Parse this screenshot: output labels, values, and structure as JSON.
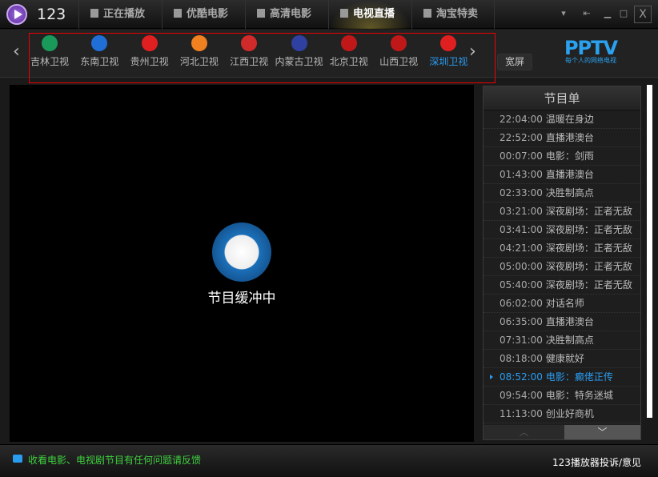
{
  "app": {
    "name": "123"
  },
  "nav_tabs": [
    {
      "label": "正在播放"
    },
    {
      "label": "优酷电影"
    },
    {
      "label": "高清电影"
    },
    {
      "label": "电视直播"
    },
    {
      "label": "淘宝特卖"
    }
  ],
  "window_buttons": {
    "close": "X"
  },
  "channels": [
    {
      "label": "吉林卫视",
      "color": "#1a9a5a"
    },
    {
      "label": "东南卫视",
      "color": "#1f6fd6"
    },
    {
      "label": "贵州卫视",
      "color": "#e02020"
    },
    {
      "label": "河北卫视",
      "color": "#f08020"
    },
    {
      "label": "江西卫视",
      "color": "#d02a2a"
    },
    {
      "label": "内蒙古卫视",
      "color": "#3040a0"
    },
    {
      "label": "北京卫视",
      "color": "#c01818"
    },
    {
      "label": "山西卫视",
      "color": "#c01818"
    },
    {
      "label": "深圳卫视",
      "color": "#e02020"
    }
  ],
  "wide_label": "宽屏",
  "pptv": {
    "logo": "PPTV",
    "slogan": "每个人的网络电视"
  },
  "video": {
    "status": "节目缓冲中"
  },
  "schedule": {
    "title": "节目单",
    "items": [
      {
        "time": "22:04:00",
        "title": "温暖在身边"
      },
      {
        "time": "22:52:00",
        "title": "直播港澳台"
      },
      {
        "time": "00:07:00",
        "title": "电影：剑雨"
      },
      {
        "time": "01:43:00",
        "title": "直播港澳台"
      },
      {
        "time": "02:33:00",
        "title": "决胜制高点"
      },
      {
        "time": "03:21:00",
        "title": "深夜剧场：正者无敌"
      },
      {
        "time": "03:41:00",
        "title": "深夜剧场：正者无敌"
      },
      {
        "time": "04:21:00",
        "title": "深夜剧场：正者无敌"
      },
      {
        "time": "05:00:00",
        "title": "深夜剧场：正者无敌"
      },
      {
        "time": "05:40:00",
        "title": "深夜剧场：正者无敌"
      },
      {
        "time": "06:02:00",
        "title": "对话名师"
      },
      {
        "time": "06:35:00",
        "title": "直播港澳台"
      },
      {
        "time": "07:31:00",
        "title": "决胜制高点"
      },
      {
        "time": "08:18:00",
        "title": "健康就好"
      },
      {
        "time": "08:52:00",
        "title": "电影：癫佬正传"
      },
      {
        "time": "09:54:00",
        "title": "电影：特务迷城"
      },
      {
        "time": "11:13:00",
        "title": "创业好商机"
      }
    ]
  },
  "status": {
    "feedback_prompt": "收看电影、电视剧节目有任何问题请反馈",
    "brand": "123播放器",
    "feedback": "投诉/意见"
  }
}
